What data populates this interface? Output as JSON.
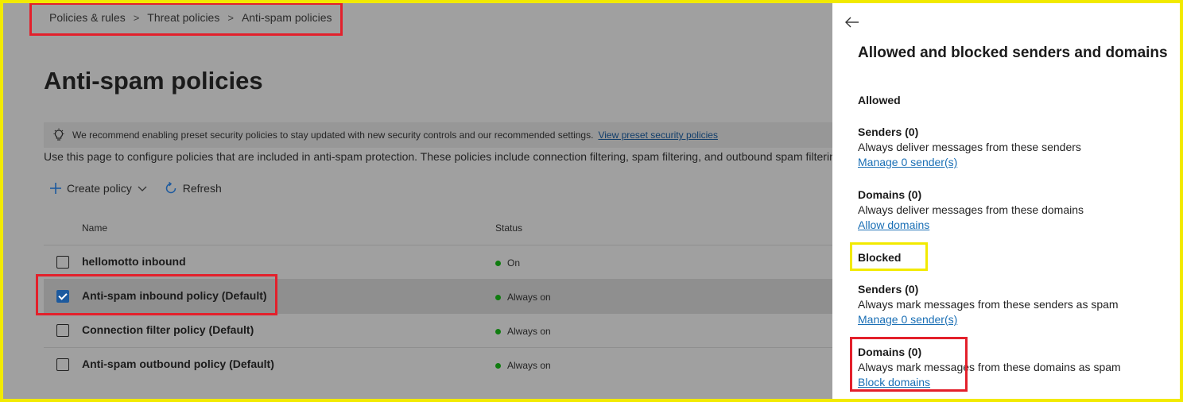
{
  "breadcrumb": {
    "items": [
      "Policies & rules",
      "Threat policies",
      "Anti-spam policies"
    ],
    "separator": ">"
  },
  "page": {
    "title": "Anti-spam policies",
    "banner_text": "We recommend enabling preset security policies to stay updated with new security controls and our recommended settings.",
    "banner_link": "View preset security policies",
    "description": "Use this page to configure policies that are included in anti-spam protection. These policies include connection filtering, spam filtering, and outbound spam filtering."
  },
  "toolbar": {
    "create_label": "Create policy",
    "refresh_label": "Refresh"
  },
  "table": {
    "columns": [
      "Name",
      "Status"
    ],
    "rows": [
      {
        "name": "hellomotto inbound",
        "status": "On",
        "checked": false
      },
      {
        "name": "Anti-spam inbound policy (Default)",
        "status": "Always on",
        "checked": true
      },
      {
        "name": "Connection filter policy (Default)",
        "status": "Always on",
        "checked": false
      },
      {
        "name": "Anti-spam outbound policy (Default)",
        "status": "Always on",
        "checked": false
      }
    ]
  },
  "panel": {
    "title": "Allowed and blocked senders and domains",
    "allowed_heading": "Allowed",
    "blocked_heading": "Blocked",
    "allowed_senders": {
      "title": "Senders (0)",
      "desc": "Always deliver messages from these senders",
      "link": "Manage 0 sender(s)"
    },
    "allowed_domains": {
      "title": "Domains (0)",
      "desc": "Always deliver messages from these domains",
      "link": "Allow domains"
    },
    "blocked_senders": {
      "title": "Senders (0)",
      "desc": "Always mark messages from these senders as spam",
      "link": "Manage 0 sender(s)"
    },
    "blocked_domains": {
      "title": "Domains (0)",
      "desc": "Always mark messages from these domains as spam",
      "link": "Block domains"
    }
  },
  "colors": {
    "highlight_red": "#e3202b",
    "highlight_yellow": "#f2ea00",
    "link": "#1a6fb5",
    "status_green": "#107c10"
  }
}
